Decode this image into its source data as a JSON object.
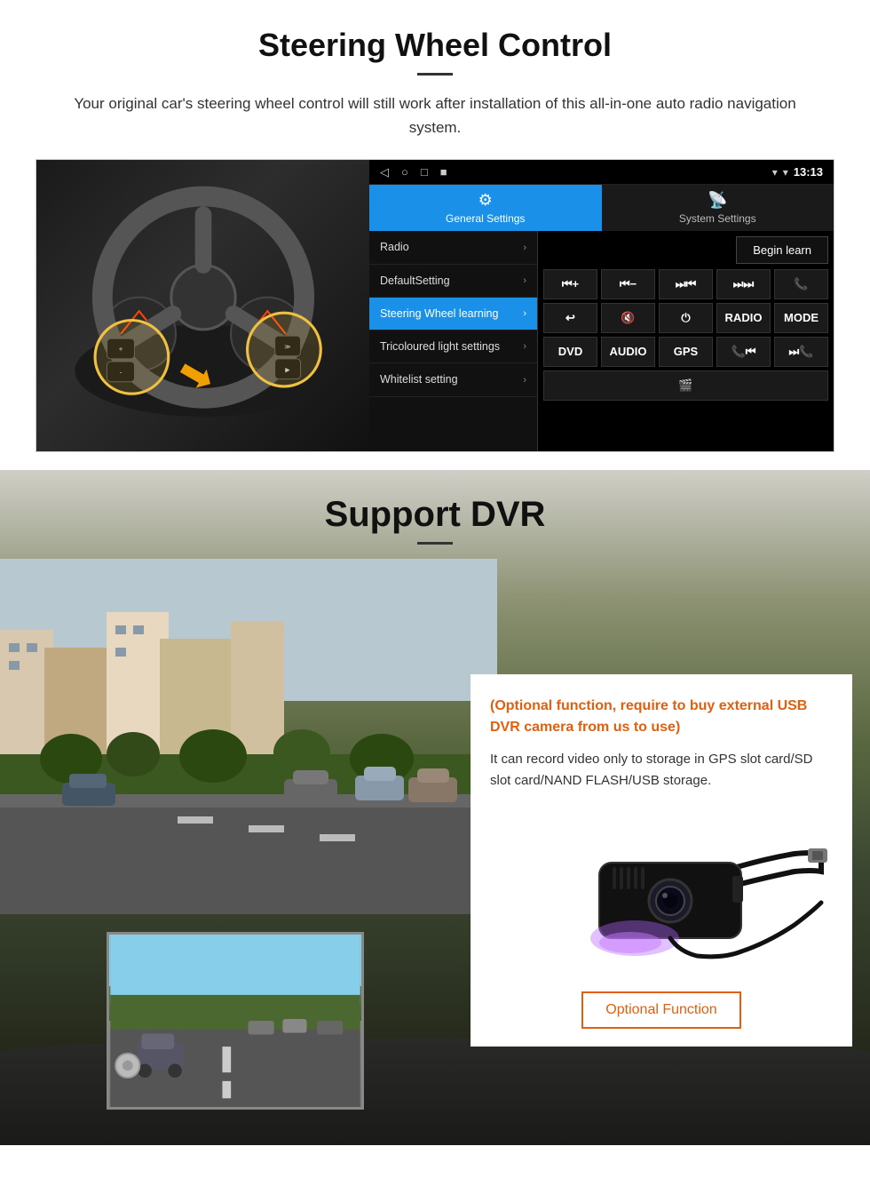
{
  "steering_section": {
    "title": "Steering Wheel Control",
    "subtitle": "Your original car's steering wheel control will still work after installation of this all-in-one auto radio navigation system.",
    "android_ui": {
      "statusbar": {
        "time": "13:13",
        "nav_icons": [
          "◁",
          "○",
          "□",
          "■"
        ]
      },
      "tabs": [
        {
          "label": "General Settings",
          "icon": "⚙",
          "active": true
        },
        {
          "label": "System Settings",
          "icon": "📡",
          "active": false
        }
      ],
      "menu_items": [
        {
          "label": "Radio",
          "active": false
        },
        {
          "label": "DefaultSetting",
          "active": false
        },
        {
          "label": "Steering Wheel learning",
          "active": true
        },
        {
          "label": "Tricoloured light settings",
          "active": false
        },
        {
          "label": "Whitelist setting",
          "active": false
        }
      ],
      "begin_learn_label": "Begin learn",
      "control_buttons": [
        [
          "⏮+",
          "⏮−",
          "⏭⏮",
          "⏭⏭",
          "📞"
        ],
        [
          "↩",
          "🔇×",
          "⏻",
          "RADIO",
          "MODE"
        ],
        [
          "DVD",
          "AUDIO",
          "GPS",
          "📞⏮",
          "⏭⏭"
        ]
      ],
      "extra_btn": "🎬"
    }
  },
  "dvr_section": {
    "title": "Support DVR",
    "info_card": {
      "orange_text": "(Optional function, require to buy external USB DVR camera from us to use)",
      "body_text": "It can record video only to storage in GPS slot card/SD slot card/NAND FLASH/USB storage.",
      "optional_button_label": "Optional Function"
    }
  }
}
